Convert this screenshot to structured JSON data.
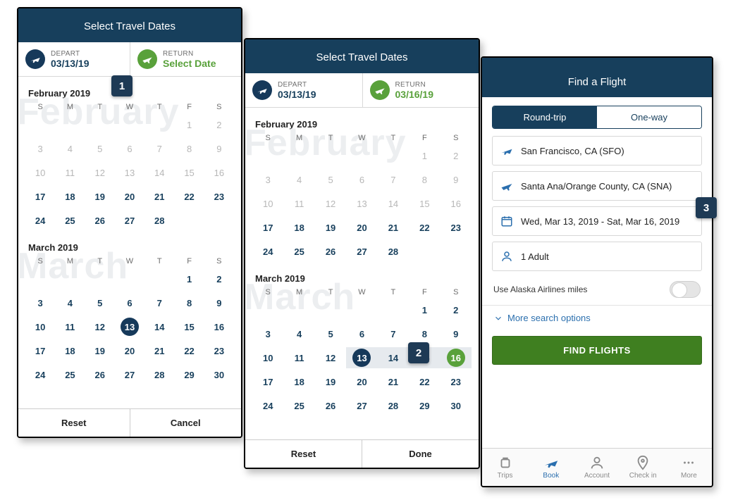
{
  "badges": {
    "b1": "1",
    "b2": "2",
    "b3": "3"
  },
  "dow": [
    "S",
    "M",
    "T",
    "W",
    "T",
    "F",
    "S"
  ],
  "feb": {
    "label": "February 2019",
    "watermark": "February",
    "startCol": 5,
    "days": 28,
    "disabledThrough": 16
  },
  "mar": {
    "label": "March 2019",
    "watermark": "March",
    "startCol": 5,
    "days": 30
  },
  "p1": {
    "title": "Select Travel Dates",
    "depart": {
      "label": "DEPART",
      "value": "03/13/19"
    },
    "return": {
      "label": "RETURN",
      "value": "Select Date"
    },
    "selectedDepart": 13,
    "actions": {
      "left": "Reset",
      "right": "Cancel"
    }
  },
  "p2": {
    "title": "Select Travel Dates",
    "depart": {
      "label": "DEPART",
      "value": "03/13/19"
    },
    "return": {
      "label": "RETURN",
      "value": "03/16/19"
    },
    "range": {
      "start": 13,
      "end": 16
    },
    "actions": {
      "left": "Reset",
      "right": "Done"
    }
  },
  "p3": {
    "title": "Find a Flight",
    "segments": {
      "active": "Round-trip",
      "inactive": "One-way"
    },
    "from": "San Francisco, CA (SFO)",
    "to": "Santa Ana/Orange County, CA (SNA)",
    "dates": "Wed, Mar 13, 2019 - Sat, Mar 16, 2019",
    "pax": "1 Adult",
    "milesLabel": "Use Alaska Airlines miles",
    "moreOptions": "More search options",
    "findBtn": "FIND FLIGHTS",
    "tabs": [
      "Trips",
      "Book",
      "Account",
      "Check in",
      "More"
    ],
    "activeTabIndex": 1
  }
}
